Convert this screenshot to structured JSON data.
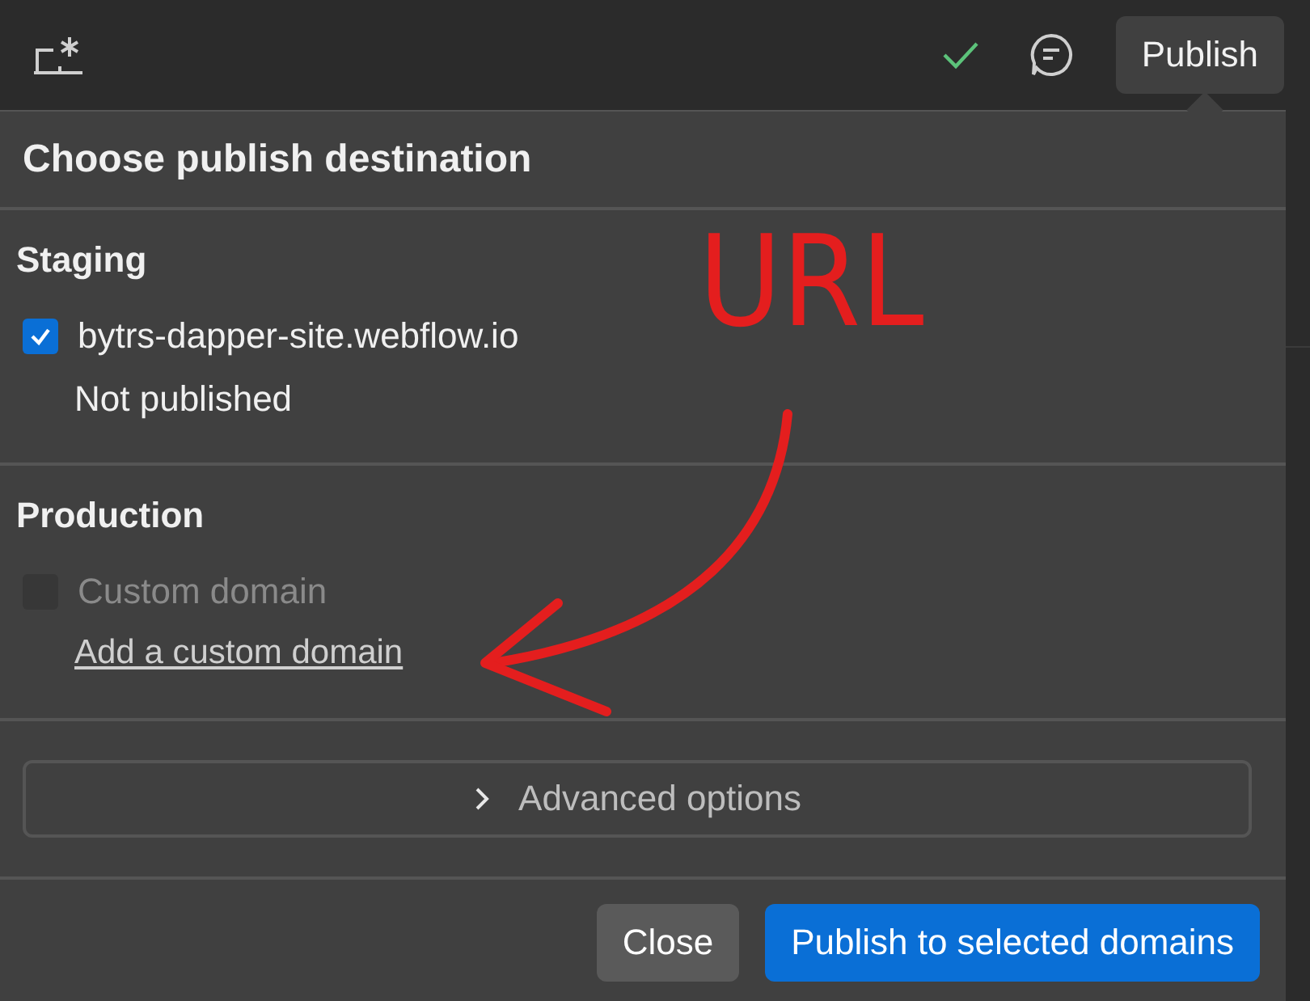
{
  "toolbar": {
    "publish_button": "Publish"
  },
  "dialog": {
    "title": "Choose publish destination",
    "sections": [
      {
        "title": "Staging",
        "options": [
          {
            "label": "bytrs-dapper-site.webflow.io",
            "checked": true,
            "disabled": false,
            "note": "Not published"
          }
        ]
      },
      {
        "title": "Production",
        "options": [
          {
            "label": "Custom domain",
            "checked": false,
            "disabled": true
          }
        ],
        "link": "Add a custom domain"
      }
    ],
    "advanced": {
      "label": "Advanced options",
      "expanded": false
    },
    "buttons": [
      {
        "label": "Close",
        "kind": "secondary"
      },
      {
        "label": "Publish to selected domains",
        "kind": "primary"
      }
    ]
  },
  "annotation": {
    "text": "URL"
  }
}
